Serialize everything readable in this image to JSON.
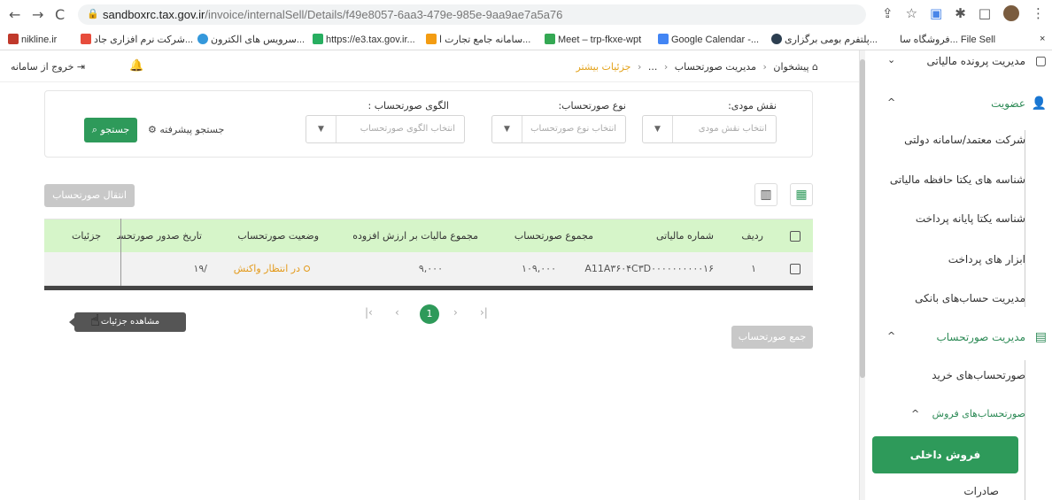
{
  "browser": {
    "url_host": "sandboxrc.tax.gov.ir",
    "url_path": "/invoice/internalSell/Details/f49e8057-6aa3-479e-985e-9aa9ae7a5a76",
    "bookmarks": [
      "nikline.ir",
      "شرکت نرم افزاری جاد...",
      "سرویس های الکترون...",
      "https://e3.tax.gov.ir...",
      "سامانه جامع تجارت ا...",
      "Meet – trp-fkxe-wpt",
      "Google Calendar -...",
      "پلتفرم بومی برگزاری...",
      "فروشگاه سا... File Sell"
    ]
  },
  "header": {
    "logout": "خروج از سامانه",
    "breadcrumb": [
      "پیشخوان",
      "مدیریت صورتحساب",
      "...",
      "جزئیات بیشتر"
    ]
  },
  "filters": {
    "role_label": "نقش مودی:",
    "role_placeholder": "انتخاب نقش مودی",
    "type_label": "نوع صورتحساب:",
    "type_placeholder": "انتخاب نوع صورتحساب",
    "pattern_label": "الگوی صورتحساب :",
    "pattern_placeholder": "انتخاب الگوی صورتحساب",
    "advanced_search": "جستجو پیشرفته",
    "search_button": "جستجو"
  },
  "actions": {
    "transfer_button": "انتقال صورتحساب",
    "sum_button": "جمع صورتحساب"
  },
  "table": {
    "headers": {
      "row": "ردیف",
      "tax_number": "شماره مالیاتی",
      "invoice_total": "مجموع صورتحساب",
      "vat_total": "مجموع مالیات بر ارزش افزوده",
      "status": "وضعیت صورتحساب",
      "issue_date": "تاریخ صدور صورتحساب",
      "details": "جزئیات"
    },
    "rows": [
      {
        "row": "۱",
        "tax_number": "A11A۳۶۰۴C۳D۰۰۰۰۰۰۰۰۰۰۱۶",
        "invoice_total": "۱۰۹,۰۰۰",
        "vat_total": "۹,۰۰۰",
        "status": "در انتظار واکنش",
        "issue_date": "/۱۹"
      }
    ],
    "tooltip": "مشاهده جزئیات"
  },
  "pagination": {
    "current": "1"
  },
  "sidebar": {
    "top_cut": "مدیریت پرونده مالیاتی",
    "membership": "عضویت",
    "membership_items": [
      "شرکت معتمد/سامانه دولتی",
      "شناسه های یکتا حافظه مالیاتی",
      "شناسه یکتا پایانه پرداخت",
      "ابزار های پرداخت",
      "مدیریت حساب‌های بانکی"
    ],
    "invoice_mgmt": "مدیریت صورتحساب",
    "purchase_invoices": "صورتحساب‌های خرید",
    "sales_invoices": "صورتحساب‌های فروش",
    "domestic_sales": "فروش داخلی",
    "exports": "صادرات"
  },
  "colors": {
    "brand": "#2e9a5a",
    "header_green": "#d6f5c9",
    "status": "#e39a1a"
  }
}
